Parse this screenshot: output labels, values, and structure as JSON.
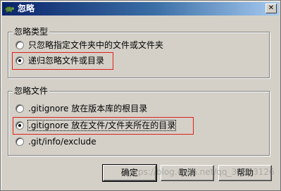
{
  "window": {
    "title": "忽略",
    "close_glyph": "✕"
  },
  "group_ignore_type": {
    "legend": "忽略类型",
    "options": [
      {
        "label": "只忽略指定文件夹中的文件或文件夹",
        "checked": false
      },
      {
        "label": "递归忽略文件或目录",
        "checked": true
      }
    ]
  },
  "group_ignore_file": {
    "legend": "忽略文件",
    "options": [
      {
        "label": ".gitignore 放在版本库的根目录",
        "checked": false
      },
      {
        "label": ".gitignore 放在文件/文件夹所在的目录",
        "checked": true
      },
      {
        "label": ".git/info/exclude",
        "checked": false
      }
    ]
  },
  "buttons": {
    "ok": "确定",
    "cancel": "取消",
    "help": "帮助"
  },
  "watermark": "https://blog.csdn.net/qq_36663126",
  "colors": {
    "highlight": "#e0201a",
    "titlebar": "#0a246a",
    "face": "#d4d0c8"
  }
}
